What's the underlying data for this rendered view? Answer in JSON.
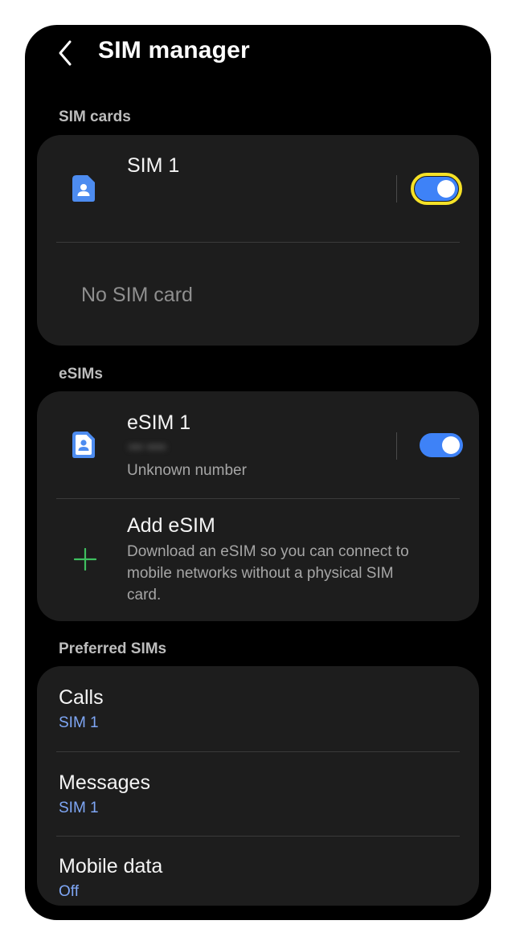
{
  "header": {
    "title": "SIM manager"
  },
  "sections": {
    "sim_cards": "SIM cards",
    "esims": "eSIMs",
    "preferred": "Preferred SIMs"
  },
  "sim_card": {
    "name": "SIM 1",
    "toggle_on": true,
    "empty_slot": "No SIM card"
  },
  "esim": {
    "name": "eSIM 1",
    "number_hidden": "••• ••••",
    "number_label": "Unknown number",
    "toggle_on": true
  },
  "add_esim": {
    "title": "Add eSIM",
    "desc_line1": "Download an eSIM so you can connect to",
    "desc_line2": "mobile networks without a physical SIM",
    "desc_line3": "card."
  },
  "preferred": [
    {
      "label": "Calls",
      "value": "SIM 1"
    },
    {
      "label": "Messages",
      "value": "SIM 1"
    },
    {
      "label": "Mobile data",
      "value": "Off"
    }
  ],
  "colors": {
    "accent": "#3e82f7",
    "focus_ring": "#f6e227",
    "add_icon": "#3fbf5f",
    "value_text": "#7fa7f6"
  },
  "icons": [
    "back-arrow-icon",
    "sim-card-icon",
    "esim-card-icon",
    "plus-icon"
  ]
}
